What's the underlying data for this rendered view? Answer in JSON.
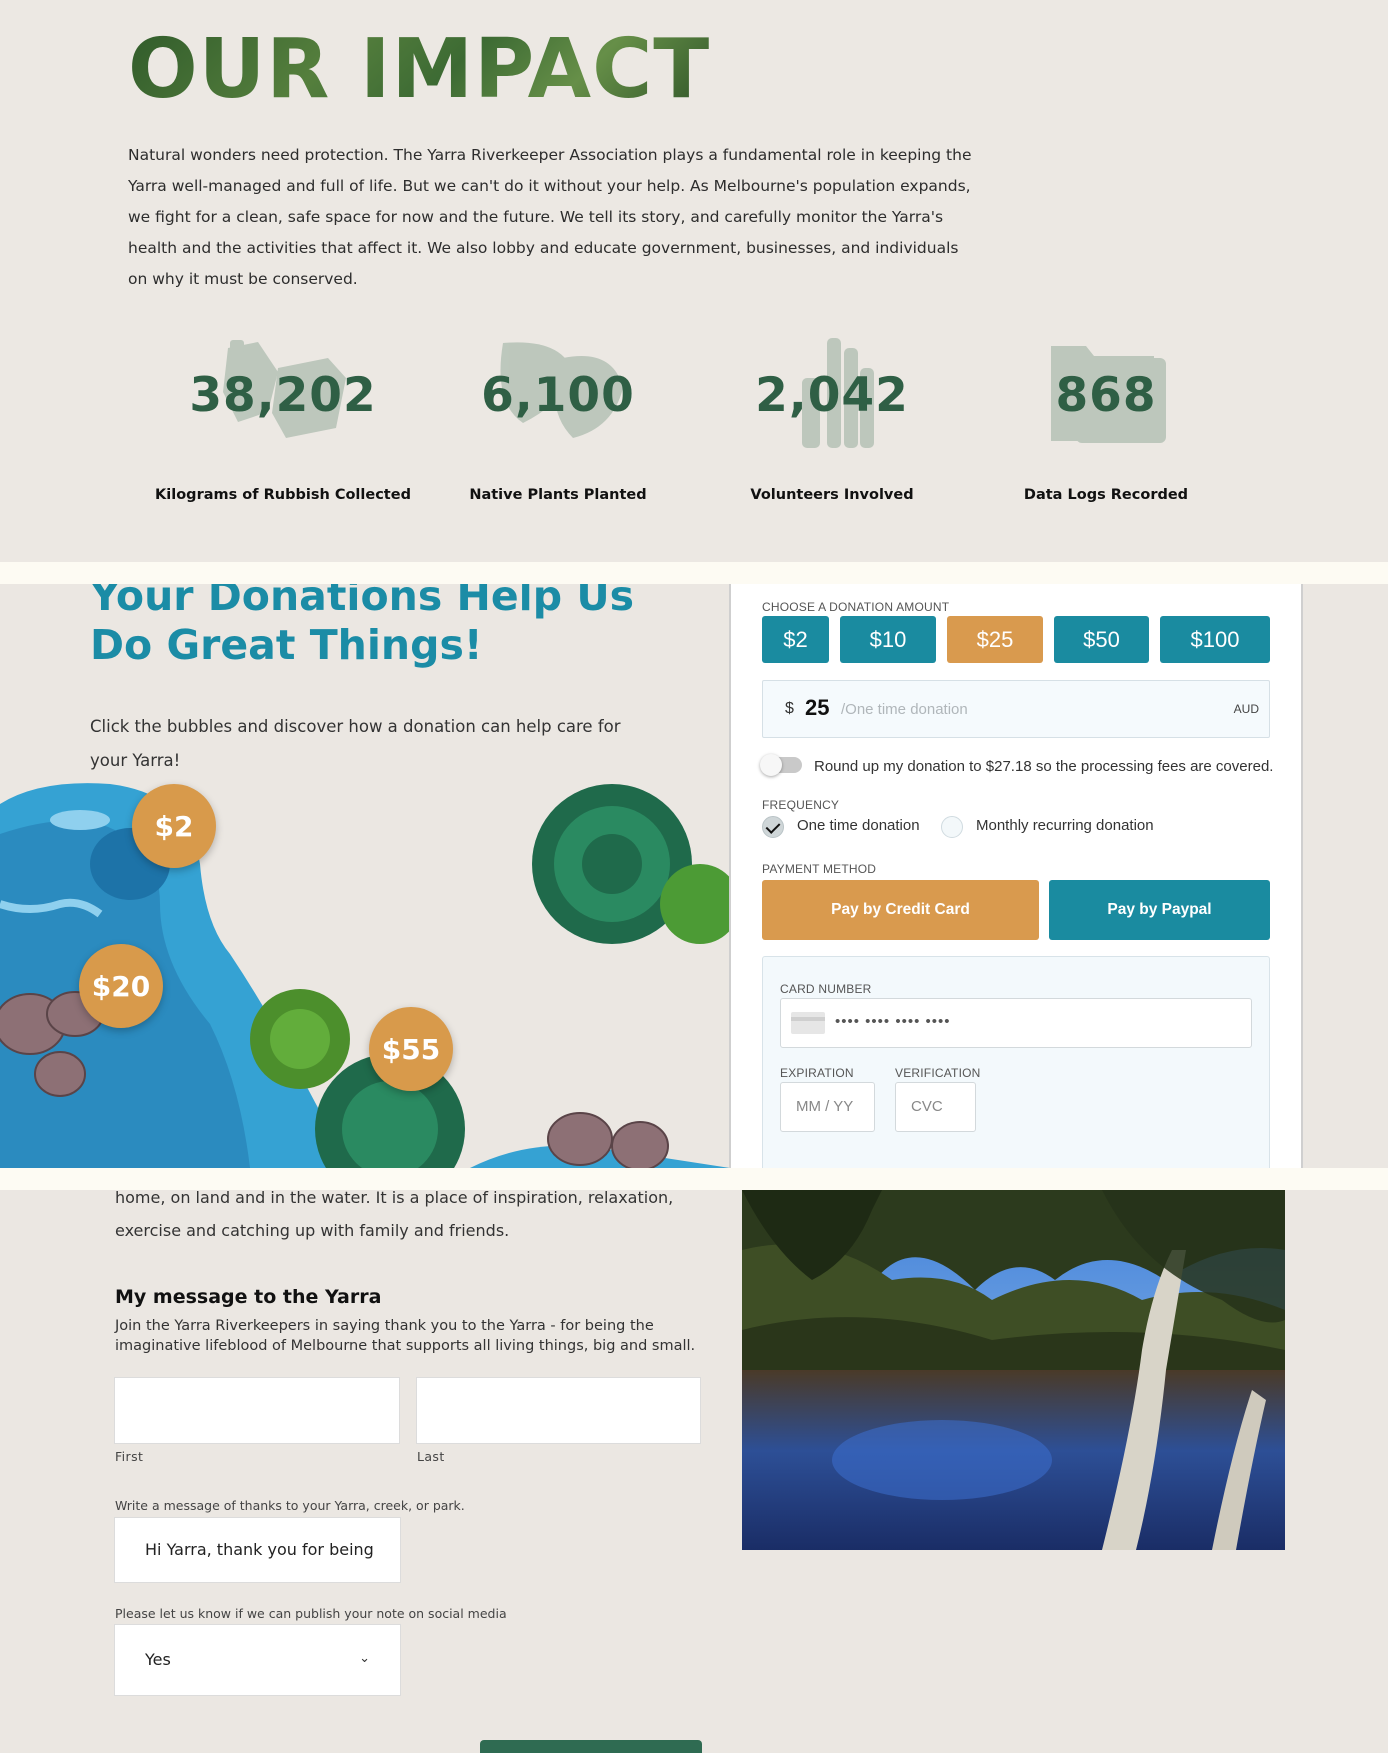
{
  "impact": {
    "title": "OUR IMPACT",
    "intro": "Natural wonders need protection. The Yarra Riverkeeper Association plays a fundamental role in keeping the Yarra well-managed and full of life. But we can't do it without your help. As Melbourne's population expands, we fight for a clean, safe space for now and the future. We tell its story, and carefully monitor the Yarra's health and the activities that affect it. We also lobby and educate government, businesses, and individuals on why it must be conserved.",
    "stats": [
      {
        "value": "38,202",
        "label": "Kilograms of Rubbish Collected",
        "icon": "rubbish-icon"
      },
      {
        "value": "6,100",
        "label": "Native Plants Planted",
        "icon": "plant-icon"
      },
      {
        "value": "2,042",
        "label": "Volunteers Involved",
        "icon": "hands-icon"
      },
      {
        "value": "868",
        "label": "Data Logs Recorded",
        "icon": "folder-icon"
      }
    ]
  },
  "donations": {
    "title_line1": "Your Donations Help Us",
    "title_line2": "Do Great Things!",
    "text": "Click the bubbles and discover how a donation can help care for your Yarra!",
    "bubbles": [
      "$2",
      "$20",
      "$55"
    ],
    "form": {
      "choose_label": "CHOOSE A DONATION AMOUNT",
      "amounts": [
        "$2",
        "$10",
        "$25",
        "$50",
        "$100"
      ],
      "selected_amount": "$25",
      "currency_symbol": "$",
      "amount_value": "25",
      "amount_placeholder": "/One time donation",
      "currency_code": "AUD",
      "round_up_label": "Round up my donation to $27.18 so the processing fees are covered.",
      "frequency_label": "FREQUENCY",
      "frequency_options": [
        "One time donation",
        "Monthly recurring donation"
      ],
      "selected_frequency": "One time donation",
      "payment_label": "PAYMENT METHOD",
      "pay_credit": "Pay by Credit Card",
      "pay_paypal": "Pay by Paypal",
      "card_number_label": "CARD NUMBER",
      "card_number_placeholder": "•••• •••• •••• ••••",
      "expiration_label": "EXPIRATION",
      "expiration_placeholder": "MM / YY",
      "verification_label": "VERIFICATION",
      "verification_placeholder": "CVC"
    },
    "colors": {
      "teal": "#1a8ba0",
      "orange": "#d99a4e",
      "green": "#2f5f45"
    }
  },
  "message": {
    "intro_tail": "home, on land and in the water. It is a place of inspiration, relaxation, exercise and catching up with family and friends.",
    "title": "My message to the Yarra",
    "subtitle": "Join the Yarra Riverkeepers in saying thank you to the Yarra - for being the imaginative lifeblood of Melbourne that supports all living things, big and small.",
    "first_label": "First",
    "last_label": "Last",
    "thanks_label": "Write a message of thanks to your Yarra, creek, or park.",
    "thanks_value": "Hi Yarra, thank you for being",
    "publish_label": "Please let us know if we can publish your note on social media",
    "publish_value": "Yes"
  }
}
